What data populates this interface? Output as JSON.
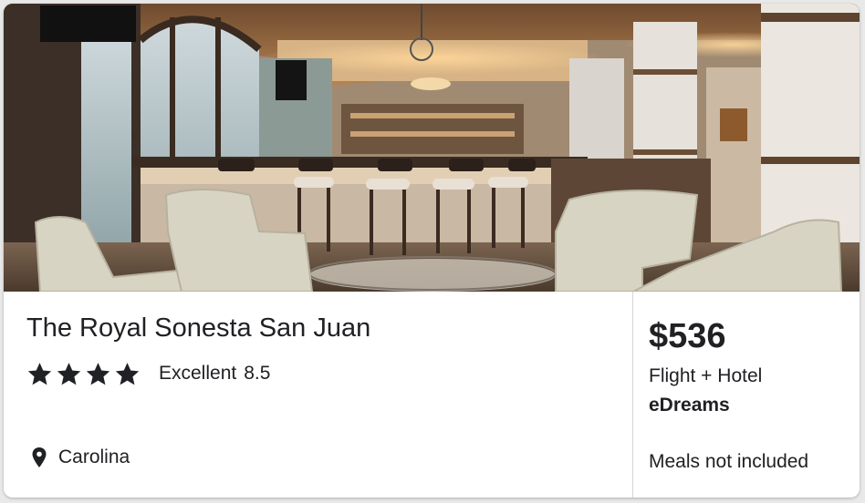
{
  "hotel": {
    "name": "The Royal Sonesta San Juan",
    "star_count": 4,
    "rating_label": "Excellent",
    "rating_score": "8.5",
    "location": "Carolina",
    "photo_subject": "hotel lobby bar with armchairs"
  },
  "offer": {
    "price": "$536",
    "package_type": "Flight + Hotel",
    "provider": "eDreams",
    "meals": "Meals not included"
  },
  "icons": {
    "star": "star-icon",
    "location": "map-pin-icon"
  },
  "colors": {
    "text": "#202124",
    "star": "#202124",
    "divider": "#d6d6d6"
  }
}
